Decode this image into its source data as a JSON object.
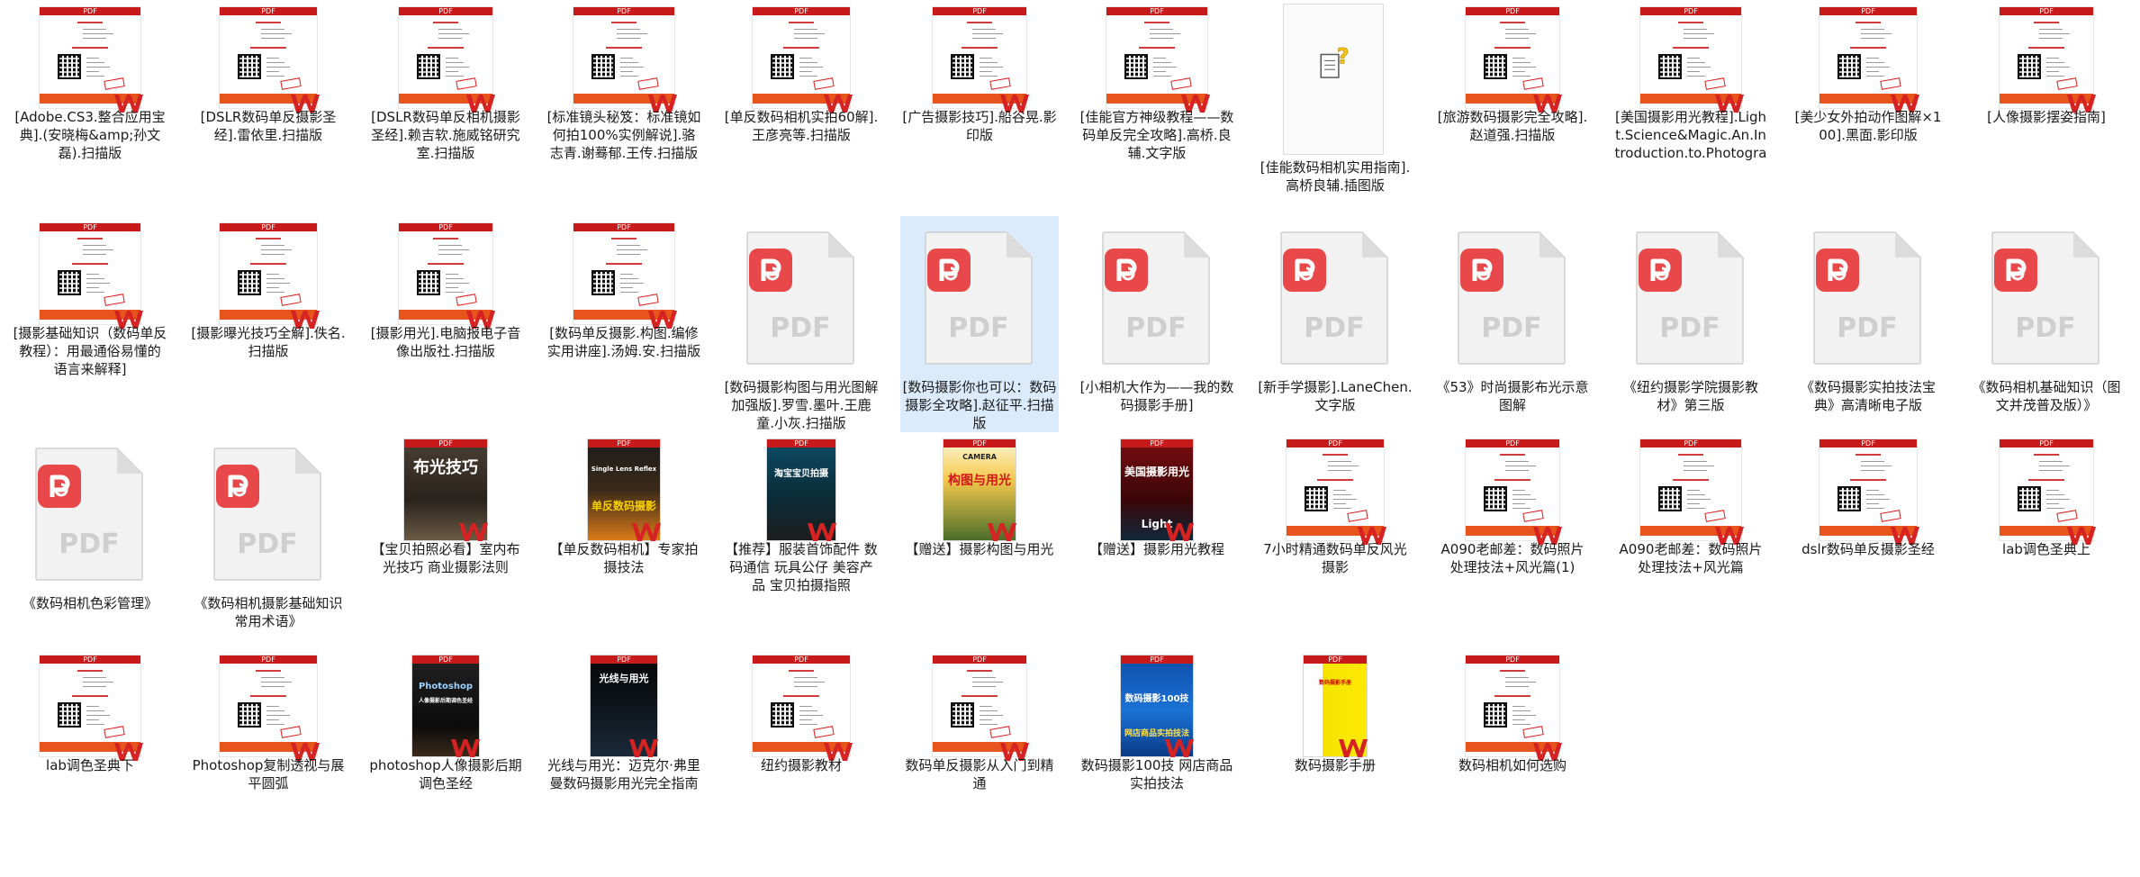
{
  "badge_pdf": "PDF",
  "items": [
    {
      "kind": "scan",
      "label": "[Adobe.CS3.整合应用宝典].(安晓梅&amp;孙文磊).扫描版"
    },
    {
      "kind": "scan",
      "label": "[DSLR数码单反摄影圣经].雷依里.扫描版"
    },
    {
      "kind": "scan",
      "label": "[DSLR数码单反相机摄影圣经].赖吉软.施威铭研究室.扫描版"
    },
    {
      "kind": "scan",
      "label": "[标准镜头秘笈：标准镜如何拍100%实例解说].骆志青.谢蓦郁.王传.扫描版"
    },
    {
      "kind": "scan",
      "label": "[单反数码相机实拍60解].王彦亮等.扫描版"
    },
    {
      "kind": "scan",
      "label": "[广告摄影技巧].船谷晃.影印版"
    },
    {
      "kind": "scan",
      "label": "[佳能官方神级教程——数码单反完全攻略].高桥.良辅.文字版"
    },
    {
      "kind": "unknown",
      "label": "[佳能数码相机实用指南].高桥良辅.插图版"
    },
    {
      "kind": "scan",
      "label": "[旅游数码摄影完全攻略].赵道强.扫描版"
    },
    {
      "kind": "scan",
      "label": "[美国摄影用光教程].Light.Science&Magic.An.Introduction.to.Photographic.Lighting"
    },
    {
      "kind": "scan",
      "label": "[美少女外拍动作图解×100].黑面.影印版"
    },
    {
      "kind": "scan",
      "label": "[人像摄影摆姿指南]"
    },
    {
      "kind": "scan",
      "label": "[摄影基础知识（数码单反教程）：用最通俗易懂的语言来解释]"
    },
    {
      "kind": "scan",
      "label": "[摄影曝光技巧全解].佚名.扫描版"
    },
    {
      "kind": "scan",
      "label": "[摄影用光].电脑报电子音像出版社.扫描版"
    },
    {
      "kind": "scan",
      "label": "[数码单反摄影.构图.编修实用讲座].汤姆.安.扫描版"
    },
    {
      "kind": "pdf",
      "label": "[数码摄影构图与用光图解加强版].罗雪.墨叶.王鹿童.小灰.扫描版"
    },
    {
      "kind": "pdf",
      "label": "[数码摄影你也可以：数码摄影全攻略].赵征平.扫描版",
      "selected": true
    },
    {
      "kind": "pdf",
      "label": "[小相机大作为——我的数码摄影手册]"
    },
    {
      "kind": "pdf",
      "label": "[新手学摄影].LaneChen.文字版"
    },
    {
      "kind": "pdf",
      "label": "《53》时尚摄影布光示意图解"
    },
    {
      "kind": "pdf",
      "label": "《纽约摄影学院摄影教材》第三版"
    },
    {
      "kind": "pdf",
      "label": "《数码摄影实拍技法宝典》高清晰电子版"
    },
    {
      "kind": "pdf",
      "label": "《数码相机基础知识（图文并茂普及版）》"
    },
    {
      "kind": "pdf",
      "label": "《数码相机色彩管理》"
    },
    {
      "kind": "pdf",
      "label": "《数码相机摄影基础知识常用术语》"
    },
    {
      "kind": "cover",
      "variant": "buguang",
      "label": "【宝贝拍照必看】室内布光技巧 商业摄影法则",
      "cover_title": "布光技巧"
    },
    {
      "kind": "cover",
      "variant": "danfan",
      "label": "【单反数码相机】专家拍摄技法",
      "cover_title": "单反数码摄影",
      "cover_sub": "Single Lens Reflex"
    },
    {
      "kind": "cover",
      "variant": "taobao",
      "label": "【推荐】服装首饰配件 数码通信 玩具公仔 美容产品 宝贝拍摄指照",
      "cover_title": "淘宝宝贝拍摄"
    },
    {
      "kind": "cover",
      "variant": "goutu",
      "label": "【赠送】摄影构图与用光",
      "cover_title": "构图与用光",
      "cover_sub": "CAMERA"
    },
    {
      "kind": "cover",
      "variant": "meiguo",
      "label": "【赠送】摄影用光教程",
      "cover_title": "美国摄影用光",
      "cover_sub": "Light"
    },
    {
      "kind": "scan",
      "label": "7小时精通数码单反风光摄影"
    },
    {
      "kind": "scan",
      "label": "A090老邮差：数码照片处理技法+风光篇(1)"
    },
    {
      "kind": "scan",
      "label": "A090老邮差：数码照片处理技法+风光篇"
    },
    {
      "kind": "scan",
      "label": "dslr数码单反摄影圣经"
    },
    {
      "kind": "scan",
      "label": "lab调色圣典上"
    },
    {
      "kind": "scan",
      "label": "lab调色圣典下"
    },
    {
      "kind": "scan",
      "label": "Photoshop复制透视与展平圆弧"
    },
    {
      "kind": "cover",
      "variant": "ps",
      "label": "photoshop人像摄影后期调色圣经",
      "cover_title": "Photoshop",
      "cover_sub": "人像摄影后期调色圣经"
    },
    {
      "kind": "cover",
      "variant": "guangxian",
      "label": "光线与用光：迈克尔·弗里曼数码摄影用光完全指南",
      "cover_title": "光线与用光"
    },
    {
      "kind": "scan",
      "label": "纽约摄影教材"
    },
    {
      "kind": "scan",
      "label": "数码单反摄影从入门到精通"
    },
    {
      "kind": "cover",
      "variant": "shuma100",
      "label": "数码摄影100技 网店商品实拍技法",
      "cover_title": "数码摄影100技",
      "cover_sub": "网店商品实拍技法"
    },
    {
      "kind": "cover",
      "variant": "shouce",
      "label": "数码摄影手册",
      "cover_title": "数码摄影手册"
    },
    {
      "kind": "scan",
      "label": "数码相机如何选购"
    }
  ]
}
